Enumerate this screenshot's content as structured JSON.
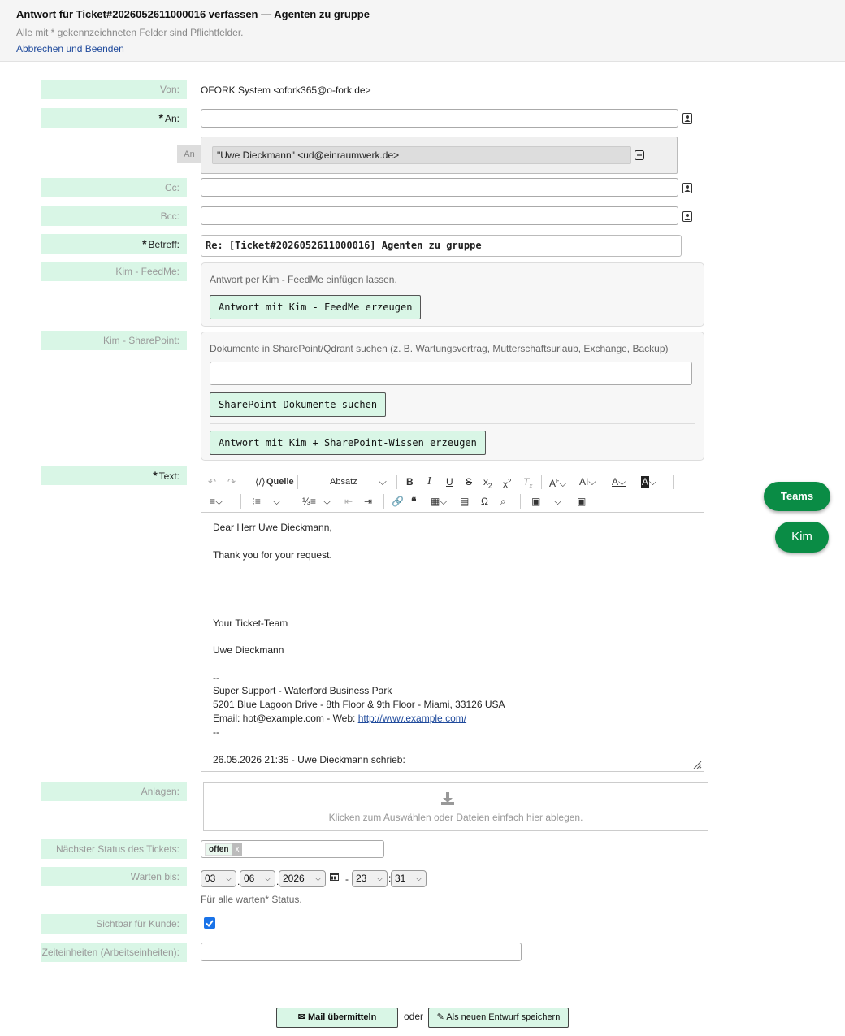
{
  "header": {
    "title": "Antwort für Ticket#2026052611000016 verfassen — Agenten zu gruppe",
    "note": "Alle mit * gekennzeichneten Felder sind Pflichtfelder.",
    "cancel_link": "Abbrechen und Beenden"
  },
  "from": {
    "label": "Von:",
    "value": "OFORK System <ofork365@o-fork.de>"
  },
  "to": {
    "label": "An:",
    "recipient_tag": "An",
    "recipient": "\"Uwe Dieckmann\" <ud@einraumwerk.de>"
  },
  "cc": {
    "label": "Cc:"
  },
  "bcc": {
    "label": "Bcc:"
  },
  "subject": {
    "label": "Betreff:",
    "value": "Re: [Ticket#2026052611000016] Agenten zu gruppe"
  },
  "feedme": {
    "label": "Kim - FeedMe:",
    "hint": "Antwort per Kim - FeedMe einfügen lassen.",
    "button": "Antwort mit Kim - FeedMe erzeugen"
  },
  "sharepoint": {
    "label": "Kim - SharePoint:",
    "hint": "Dokumente in SharePoint/Qdrant suchen (z. B. Wartungsvertrag, Mutterschaftsurlaub, Exchange, Backup)",
    "search_button": "SharePoint-Dokumente suchen",
    "generate_button": "Antwort mit Kim + SharePoint-Wissen erzeugen"
  },
  "text": {
    "label": "Text:",
    "toolbar": {
      "source": "Quelle",
      "format": "Absatz"
    },
    "lines": {
      "l1": "Dear Herr Uwe Dieckmann,",
      "l2": "Thank you for your request.",
      "l3": "Your Ticket-Team",
      "l4": "Uwe Dieckmann",
      "l5": "--",
      "l6": "Super Support - Waterford Business Park",
      "l7": "5201 Blue Lagoon Drive - 8th Floor & 9th Floor - Miami, 33126 USA",
      "l8": "Email: hot@example.com - Web: ",
      "l8_link": "http://www.example.com/",
      "l9": "--",
      "l10": "26.05.2026 21:35 - Uwe Dieckmann schrieb:"
    }
  },
  "attachments": {
    "label": "Anlagen:",
    "hint": "Klicken zum Auswählen oder Dateien einfach hier ablegen."
  },
  "next_state": {
    "label": "Nächster Status des Tickets:",
    "value": "offen"
  },
  "pending": {
    "label": "Warten bis:",
    "day": "03",
    "month": "06",
    "year": "2026",
    "hour": "23",
    "minute": "31",
    "hint": "Für alle warten* Status."
  },
  "visible": {
    "label": "Sichtbar für Kunde:",
    "checked": true
  },
  "time_units": {
    "label": "Zeiteinheiten (Arbeitseinheiten):"
  },
  "floating": {
    "teams": "Teams",
    "kim": "Kim"
  },
  "footer": {
    "submit": "Mail übermitteln",
    "or": "oder",
    "draft": "Als neuen Entwurf speichern"
  }
}
